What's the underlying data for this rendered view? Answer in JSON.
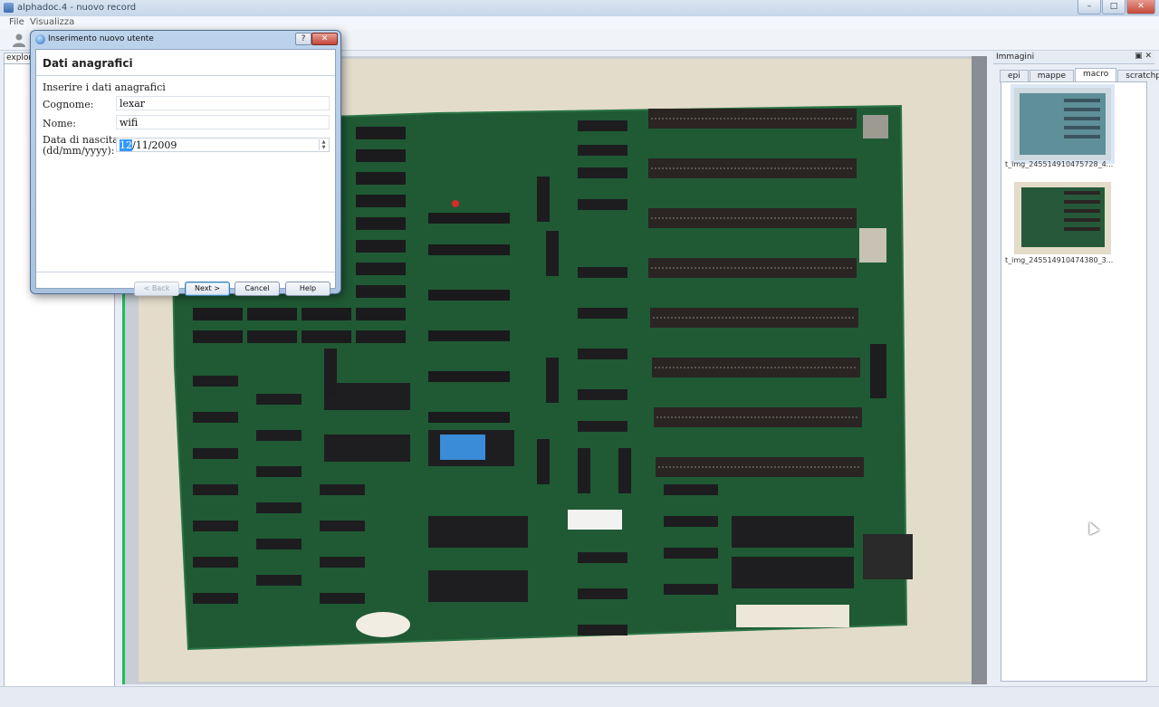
{
  "window": {
    "title": "alphadoc.4 - nuovo record",
    "minimize": "–",
    "maximize": "□",
    "close": "✕"
  },
  "menu": {
    "items": [
      "File",
      "Visualizza"
    ]
  },
  "toolbar": {
    "icon": "user-icon"
  },
  "explorer": {
    "tab_label": "explorer"
  },
  "right_panel": {
    "title": "Immagini",
    "controls": "▣ ✕",
    "tabs": [
      {
        "label": "epi",
        "active": false
      },
      {
        "label": "mappe",
        "active": false
      },
      {
        "label": "macro",
        "active": true
      },
      {
        "label": "scratchpad",
        "active": false
      }
    ],
    "thumbnails": [
      {
        "caption": "t_img_245514910475728_4...",
        "selected": true
      },
      {
        "caption": "t_img_245514910474380_3...",
        "selected": false
      }
    ]
  },
  "dialog": {
    "title": "Inserimento nuovo utente",
    "help_button": "?",
    "close_button": "✕",
    "heading": "Dati anagrafici",
    "subheading": "Inserire i dati anagrafici",
    "fields": {
      "surname_label": "Cognome:",
      "surname_value": "lexar",
      "name_label": "Nome:",
      "name_value": "wifi",
      "birthdate_label_line1": "Data di nascita",
      "birthdate_label_line2": "(dd/mm/yyyy):",
      "birthdate_day": "12",
      "birthdate_rest": "/11/2009"
    },
    "buttons": {
      "back": "< Back",
      "next": "Next >",
      "cancel": "Cancel",
      "help": "Help"
    }
  },
  "colors": {
    "selection": "#3399ff",
    "board": "#1f5a34",
    "viewer_edge": "#19c05a"
  }
}
